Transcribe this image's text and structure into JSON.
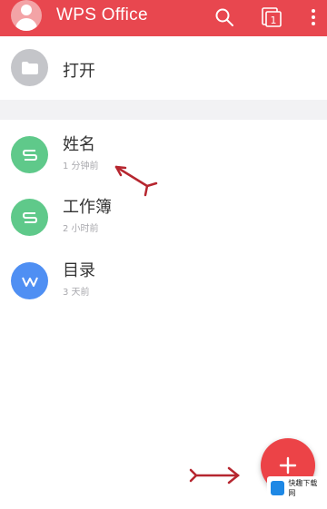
{
  "header": {
    "title": "WPS Office",
    "color": "#e8474f",
    "avatar_icon": "user-avatar-icon",
    "search_icon": "search-icon",
    "tabs_icon": "tabs-icon",
    "tabs_count": "1",
    "more_icon": "more-vertical-icon"
  },
  "open_row": {
    "label": "打开",
    "icon": "folder-icon",
    "icon_color": "#c4c5c9"
  },
  "files": [
    {
      "name": "姓名",
      "time": "1 分钟前",
      "type": "spreadsheet",
      "icon": "spreadsheet-icon",
      "color": "#5fc98a"
    },
    {
      "name": "工作簿",
      "time": "2 小时前",
      "type": "spreadsheet",
      "icon": "spreadsheet-icon",
      "color": "#5fc98a"
    },
    {
      "name": "目录",
      "time": "3 天前",
      "type": "document",
      "icon": "document-icon",
      "color": "#4f8ff3"
    }
  ],
  "fab": {
    "icon": "plus-icon",
    "color": "#ec4347"
  },
  "annotations": {
    "arrow_color": "#b6262f",
    "arrows": [
      "arrow-to-file",
      "arrow-to-fab"
    ]
  },
  "watermark": {
    "text": "快趣下载网",
    "icon": "logo-icon"
  }
}
